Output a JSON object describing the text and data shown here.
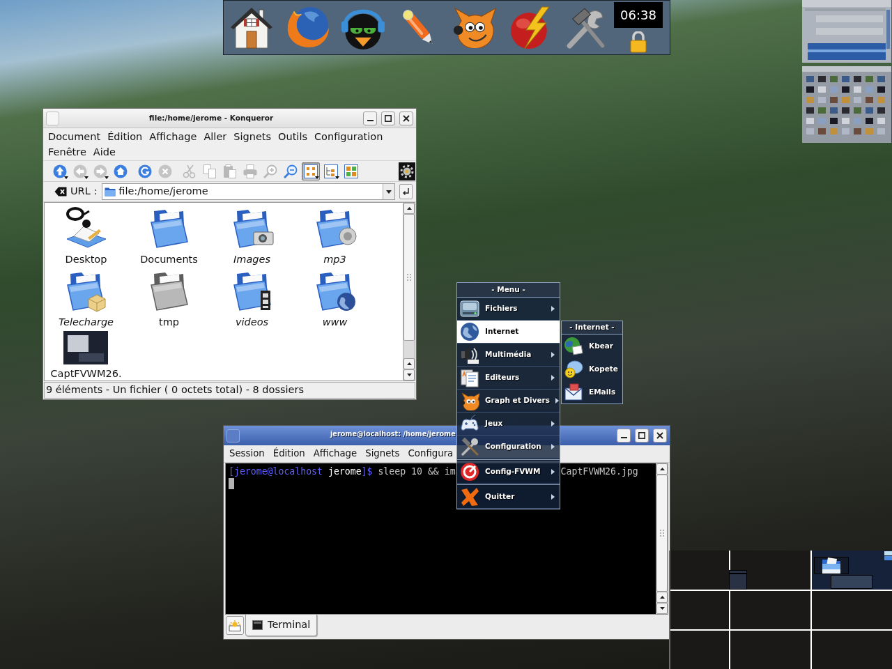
{
  "dock": {
    "clock": "06:38"
  },
  "file_manager": {
    "title": "file:/home/jerome - Konqueror",
    "menu": [
      "Document",
      "Édition",
      "Affichage",
      "Aller",
      "Signets",
      "Outils",
      "Configuration",
      "Fenêtre",
      "Aide"
    ],
    "toolbar": {
      "navigation": [
        {
          "disabled": false,
          "dropdown": true
        },
        {
          "disabled": true,
          "dropdown": true
        },
        {
          "disabled": true,
          "dropdown": true
        },
        {
          "disabled": false,
          "dropdown": false
        },
        {
          "disabled": false,
          "dropdown": false
        },
        {
          "disabled": true,
          "dropdown": false
        }
      ],
      "edit": [
        {
          "disabled": true
        },
        {
          "disabled": true
        },
        {
          "disabled": true
        },
        {
          "disabled": true
        },
        {
          "disabled": true
        },
        {
          "disabled": false
        }
      ],
      "views": [
        {
          "selected": true,
          "dropdown": true
        },
        {
          "selected": false,
          "dropdown": true
        },
        {
          "selected": false,
          "dropdown": false
        }
      ]
    },
    "location": {
      "label": "URL :",
      "value": "file:/home/jerome"
    },
    "items": [
      {
        "name": "Desktop",
        "kind": "folder",
        "link": false
      },
      {
        "name": "Documents",
        "kind": "folder",
        "link": false
      },
      {
        "name": "Images",
        "kind": "folder",
        "link": true
      },
      {
        "name": "mp3",
        "kind": "folder",
        "link": true
      },
      {
        "name": "Telecharge",
        "kind": "folder",
        "link": true
      },
      {
        "name": "tmp",
        "kind": "folder",
        "link": false
      },
      {
        "name": "videos",
        "kind": "folder",
        "link": true
      },
      {
        "name": "www",
        "kind": "folder",
        "link": true
      },
      {
        "name": "CaptFVWM26.",
        "kind": "image",
        "link": false
      }
    ],
    "status": "9 éléments - Un fichier ( 0 octets total) - 8 dossiers"
  },
  "terminal": {
    "title": "jerome@localhost: /home/jerome",
    "menu": [
      "Session",
      "Édition",
      "Affichage",
      "Signets",
      "Configura"
    ],
    "line": {
      "host": "[jerome@localhost",
      "directory": "jerome",
      "end": "]$",
      "command": "sleep 10 && im",
      "tail": "CaptFVWM26.jpg"
    },
    "tabs": [
      {
        "label": "Terminal",
        "selected": true
      }
    ]
  },
  "menu": {
    "title": "- Menu -",
    "items": [
      {
        "label": "Fichiers",
        "arrow": true,
        "selected": false,
        "separator_above": false
      },
      {
        "label": "Internet",
        "arrow": false,
        "selected": true,
        "separator_above": false
      },
      {
        "label": "Multimédia",
        "arrow": true,
        "selected": false,
        "separator_above": false
      },
      {
        "label": "Editeurs",
        "arrow": true,
        "selected": false,
        "separator_above": false
      },
      {
        "label": "Graph et Divers",
        "arrow": true,
        "selected": false,
        "separator_above": false
      },
      {
        "label": "Jeux",
        "arrow": true,
        "selected": false,
        "separator_above": false
      },
      {
        "label": "Configuration",
        "arrow": true,
        "selected": false,
        "separator_above": false
      },
      {
        "label": "Config-FVWM",
        "arrow": true,
        "selected": false,
        "separator_above": true
      },
      {
        "label": "Quitter",
        "arrow": true,
        "selected": false,
        "separator_above": true
      }
    ]
  },
  "submenu": {
    "title": "- Internet -",
    "items": [
      "Kbear",
      "Kopete",
      "EMails"
    ]
  },
  "pager": {
    "desks": [
      {
        "selected": false
      },
      {
        "selected": false
      },
      {
        "selected": true
      },
      {
        "selected": false
      },
      {
        "selected": false
      },
      {
        "selected": false
      },
      {
        "selected": false
      },
      {
        "selected": false
      },
      {
        "selected": false
      }
    ]
  }
}
